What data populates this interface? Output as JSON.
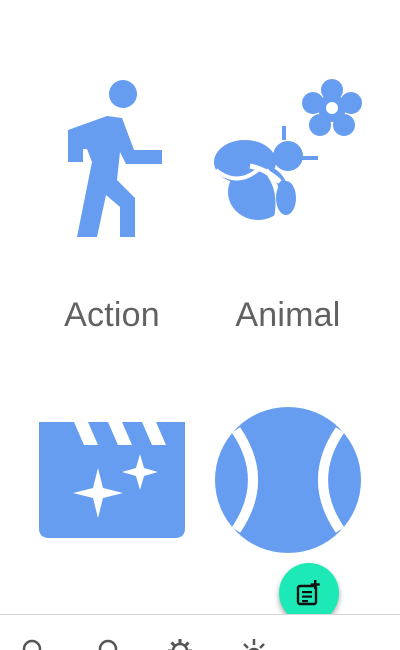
{
  "categories": [
    {
      "label": "Action",
      "icon": "walking-person-icon"
    },
    {
      "label": "Animal",
      "icon": "bee-flower-icon"
    },
    {
      "label": "",
      "icon": "clapperboard-sparkle-icon"
    },
    {
      "label": "",
      "icon": "tennis-ball-icon"
    }
  ],
  "fab": {
    "icon": "add-note-icon"
  },
  "bottom_nav": {
    "icons": [
      "search-icon",
      "search-icon",
      "settings-icon",
      "tips-icon"
    ]
  },
  "colors": {
    "icon_blue": "#679df0",
    "label_gray": "#616161",
    "fab_teal": "#1de9b6"
  }
}
